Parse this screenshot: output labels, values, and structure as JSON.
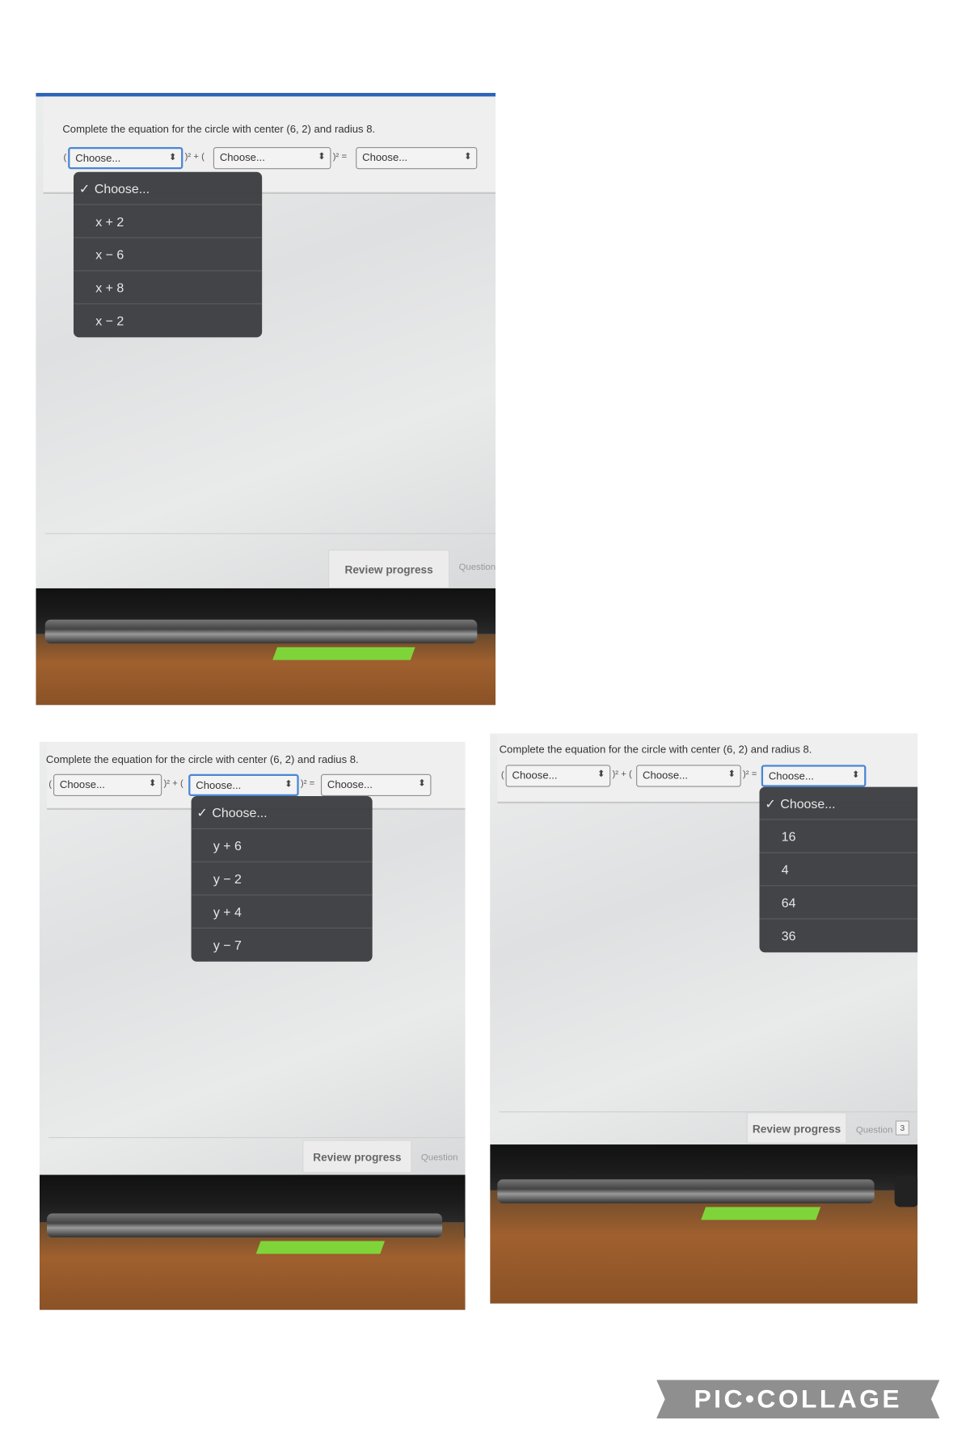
{
  "question": "Complete the equation for the circle with center (6, 2) and radius 8.",
  "operators": {
    "open": "(",
    "mid": ")² + (",
    "end": ")² ="
  },
  "placeholder": "Choose...",
  "selected_check": "✓",
  "review_label": "Review progress",
  "question_label": "Question",
  "question_number": "3",
  "panels": [
    {
      "focused_select": 0,
      "options": [
        "Choose...",
        "x + 2",
        "x − 6",
        "x + 8",
        "x − 2"
      ]
    },
    {
      "focused_select": 1,
      "options": [
        "Choose...",
        "y + 6",
        "y − 2",
        "y + 4",
        "y − 7"
      ]
    },
    {
      "focused_select": 2,
      "options": [
        "Choose...",
        "16",
        "4",
        "64",
        "36"
      ]
    }
  ],
  "logo": "PIC•COLLAGE",
  "colors": {
    "focus": "#4a86d4",
    "dropdown": "#3d3e41",
    "topbar": "#2d63b8",
    "clip": "#7fd43a"
  }
}
